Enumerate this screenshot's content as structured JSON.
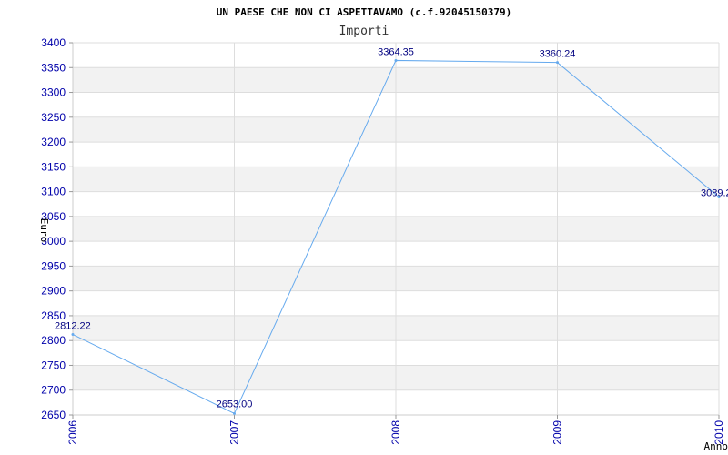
{
  "chart_data": {
    "type": "line",
    "title": "UN PAESE CHE NON CI ASPETTAVAMO (c.f.92045150379)",
    "subtitle": "Importi",
    "xlabel": "Anno",
    "ylabel": "Euro",
    "categories": [
      "2006",
      "2007",
      "2008",
      "2009",
      "2010"
    ],
    "series": [
      {
        "values": [
          2812.22,
          2653.0,
          3364.35,
          3360.24,
          3089.2
        ],
        "labels": [
          "2812.22",
          "2653.00",
          "3364.35",
          "3360.24",
          "3089.2"
        ]
      }
    ],
    "ylim": [
      2650,
      3400
    ],
    "yticks": [
      2650,
      2700,
      2750,
      2800,
      2850,
      2900,
      2950,
      3000,
      3050,
      3100,
      3150,
      3200,
      3250,
      3300,
      3350,
      3400
    ],
    "grid": true,
    "colors": {
      "line": "#66aaee",
      "band": "#f2f2f2",
      "grid": "#dddddd",
      "tick_text": "#0000aa",
      "data_label": "#000080"
    }
  }
}
